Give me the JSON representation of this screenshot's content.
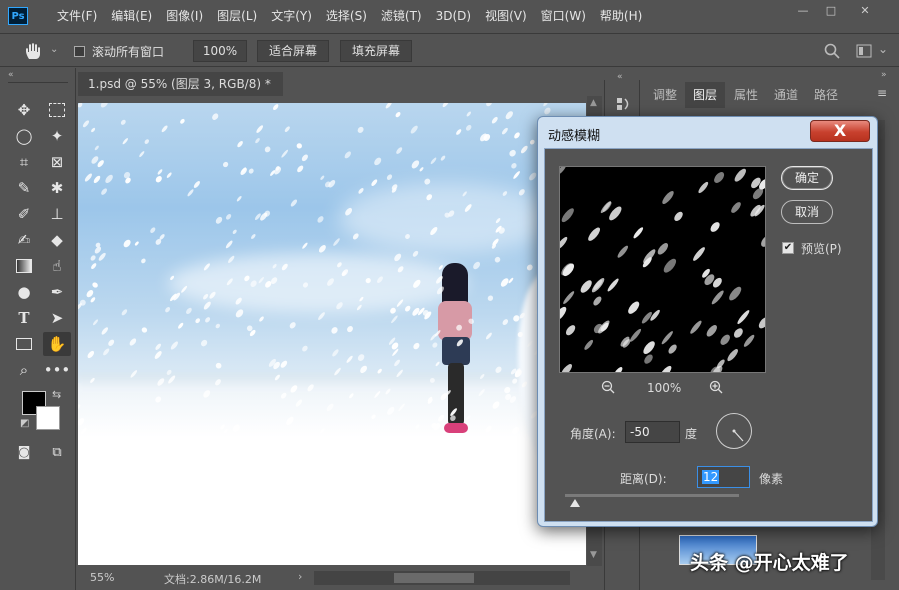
{
  "app": {
    "logo": "Ps"
  },
  "menu": [
    "文件(F)",
    "编辑(E)",
    "图像(I)",
    "图层(L)",
    "文字(Y)",
    "选择(S)",
    "滤镜(T)",
    "3D(D)",
    "视图(V)",
    "窗口(W)",
    "帮助(H)"
  ],
  "window_controls": {
    "minimize": "—",
    "maximize": "□",
    "close": "✕"
  },
  "options": {
    "scroll_all_label": "滚动所有窗口",
    "zoom_value": "100%",
    "fit_screen": "适合屏幕",
    "fill_screen": "填充屏幕"
  },
  "document": {
    "tab_title": "1.psd @ 55% (图层 3, RGB/8) *",
    "tab_close": "×"
  },
  "status": {
    "zoom": "55%",
    "doc_info": "文档:2.86M/16.2M",
    "arrow": "›"
  },
  "panels": {
    "tabs": [
      "调整",
      "图层",
      "属性",
      "通道",
      "路径"
    ],
    "active_tab": "图层"
  },
  "dialog": {
    "title": "动感模糊",
    "close": "X",
    "ok": "确定",
    "cancel": "取消",
    "preview_label": "预览(P)",
    "preview_checked": true,
    "zoom_out": "−",
    "zoom_value": "100%",
    "zoom_in": "+",
    "angle_label": "角度(A):",
    "angle_value": "-50",
    "angle_unit": "度",
    "distance_label": "距离(D):",
    "distance_value": "12",
    "distance_unit": "像素"
  },
  "watermark": "头条 @开心太难了",
  "colors": {
    "ui_bg": "#535353",
    "dialog_frame": "#cfe0f1",
    "close_red": "#c8412e",
    "selection_blue": "#3399ff"
  }
}
